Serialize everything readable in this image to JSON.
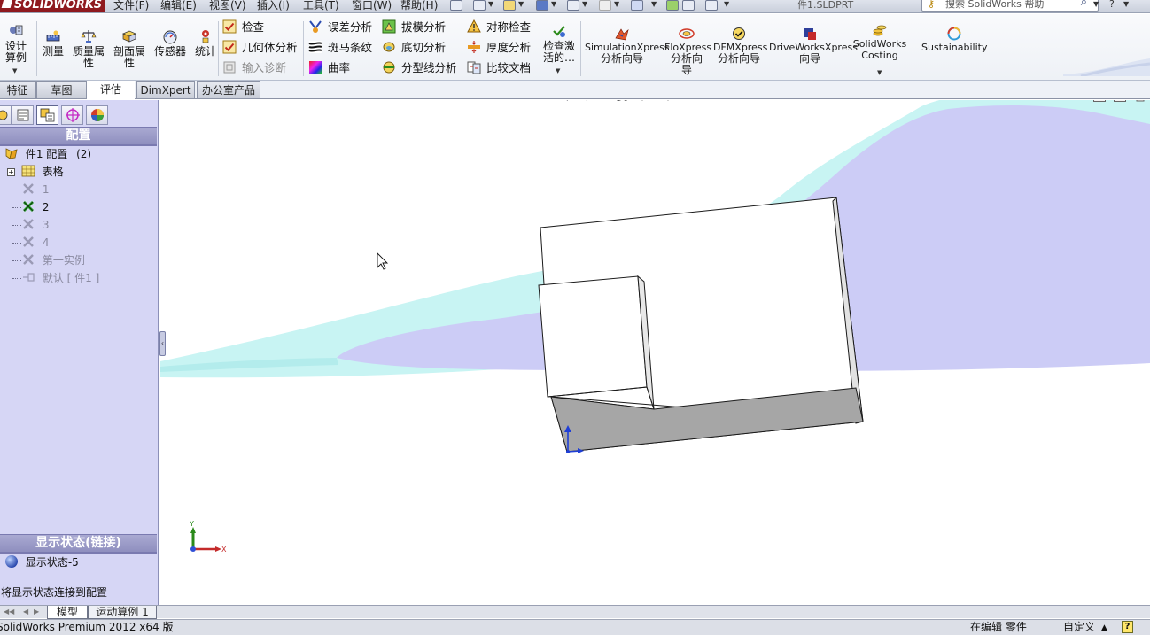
{
  "app": {
    "logo": "SOLIDWORKS",
    "document_title": "件1.SLDPRT",
    "menus": [
      "文件(F)",
      "编辑(E)",
      "视图(V)",
      "插入(I)",
      "工具(T)",
      "窗口(W)",
      "帮助(H)"
    ],
    "search": {
      "placeholder": "搜索 SolidWorks 帮助"
    }
  },
  "ribbon": {
    "large_buttons": [
      {
        "id": "design-study",
        "label": "设计算例",
        "icon": "design-study-icon"
      },
      {
        "id": "measure",
        "label": "测量",
        "icon": "measure-icon"
      },
      {
        "id": "mass-properties",
        "label": "质量属性",
        "icon": "mass-properties-icon"
      },
      {
        "id": "section-properties",
        "label": "剖面属性",
        "icon": "section-properties-icon"
      },
      {
        "id": "sensor",
        "label": "传感器",
        "icon": "sensor-icon"
      },
      {
        "id": "statistics",
        "label": "统计",
        "icon": "statistics-icon"
      }
    ],
    "small_buttons": [
      {
        "id": "check",
        "label": "检查",
        "enabled": true
      },
      {
        "id": "geometry-analysis",
        "label": "几何体分析",
        "enabled": true
      },
      {
        "id": "import-diagnostics",
        "label": "输入诊断",
        "enabled": false
      },
      {
        "id": "deviation-analysis",
        "label": "误差分析",
        "enabled": true
      },
      {
        "id": "zebra-stripes",
        "label": "斑马条纹",
        "enabled": true
      },
      {
        "id": "curvature",
        "label": "曲率",
        "enabled": true
      },
      {
        "id": "draft-analysis",
        "label": "拔模分析",
        "enabled": true
      },
      {
        "id": "undercut-analysis",
        "label": "底切分析",
        "enabled": true
      },
      {
        "id": "parting-line-analysis",
        "label": "分型线分析",
        "enabled": true
      },
      {
        "id": "symmetry-check",
        "label": "对称检查",
        "enabled": true
      },
      {
        "id": "thickness-analysis",
        "label": "厚度分析",
        "enabled": true
      },
      {
        "id": "compare-documents",
        "label": "比较文档",
        "enabled": true
      }
    ],
    "check_active": "检查激活的…",
    "tools": [
      {
        "id": "simulationxpress",
        "line1": "SimulationXpress",
        "line2": "分析向导"
      },
      {
        "id": "floxpress",
        "line1": "FloXpress",
        "line2": "分析向导"
      },
      {
        "id": "dfmxpress",
        "line1": "DFMXpress",
        "line2": "分析向导"
      },
      {
        "id": "driveworksxpress",
        "line1": "DriveWorksXpress",
        "line2": "向导"
      },
      {
        "id": "solidworks-costing",
        "line1": "SolidWorks",
        "line2": "Costing"
      },
      {
        "id": "sustainability",
        "line1": "Sustainability",
        "line2": ""
      }
    ]
  },
  "tabs": [
    "特征",
    "草图",
    "评估",
    "DimXpert",
    "办公室产品"
  ],
  "active_tab": "评估",
  "manager": {
    "title": "配置",
    "root": {
      "label": "件1 配置",
      "count": "(2)"
    },
    "table_node": "表格",
    "configs": [
      {
        "label": "1",
        "active": false
      },
      {
        "label": "2",
        "active": true
      },
      {
        "label": "3",
        "active": false
      },
      {
        "label": "4",
        "active": false
      },
      {
        "label": "第一实例",
        "active": false
      },
      {
        "label": "默认 [ 件1 ]",
        "active": false
      }
    ],
    "display_states_title": "显示状态(链接)",
    "display_state": "显示状态-5",
    "link_note": "将显示状态连接到配置"
  },
  "triad": {
    "x": "X",
    "y": "Y"
  },
  "bottom_tabs": [
    "模型",
    "运动算例 1"
  ],
  "status": {
    "product": "SolidWorks Premium 2012 x64 版",
    "editing": "在编辑 零件",
    "units": "自定义",
    "help": "?"
  },
  "colors": {
    "panel_bg": "#d6d6f5",
    "scene_lavender": "#ccccf6",
    "scene_cyan": "#c8f4f3",
    "part_edge": "#1a1a1a",
    "part_shadow_face": "#a6a6a6",
    "brand": "#8f1a1f"
  }
}
